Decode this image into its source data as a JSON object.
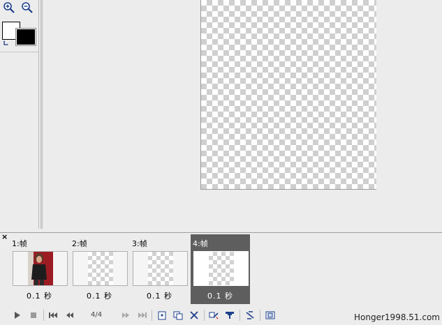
{
  "frames": [
    {
      "label": "1:帧",
      "delay": "0.1 秒",
      "kind": "photo",
      "selected": false
    },
    {
      "label": "2:帧",
      "delay": "0.1 秒",
      "kind": "transparent",
      "selected": false
    },
    {
      "label": "3:帧",
      "delay": "0.1 秒",
      "kind": "transparent",
      "selected": false
    },
    {
      "label": "4:帧",
      "delay": "0.1 秒",
      "kind": "transparent",
      "selected": true
    }
  ],
  "playback": {
    "counter": "4/4"
  },
  "watermark": "Honger1998.51.com",
  "colors": {
    "foreground": "#ffffff",
    "background": "#000000",
    "selected_frame": "#5e5e5e"
  },
  "icons": [
    "zoom-in-icon",
    "zoom-out-icon",
    "swap-colors-icon",
    "close-icon",
    "play-icon",
    "stop-icon",
    "first-frame-icon",
    "prev-frame-icon",
    "next-frame-icon",
    "last-frame-icon",
    "new-frame-icon",
    "duplicate-frame-icon",
    "delete-frame-icon",
    "tween-icon",
    "optimize-icon",
    "reverse-frames-icon",
    "export-frames-icon"
  ]
}
